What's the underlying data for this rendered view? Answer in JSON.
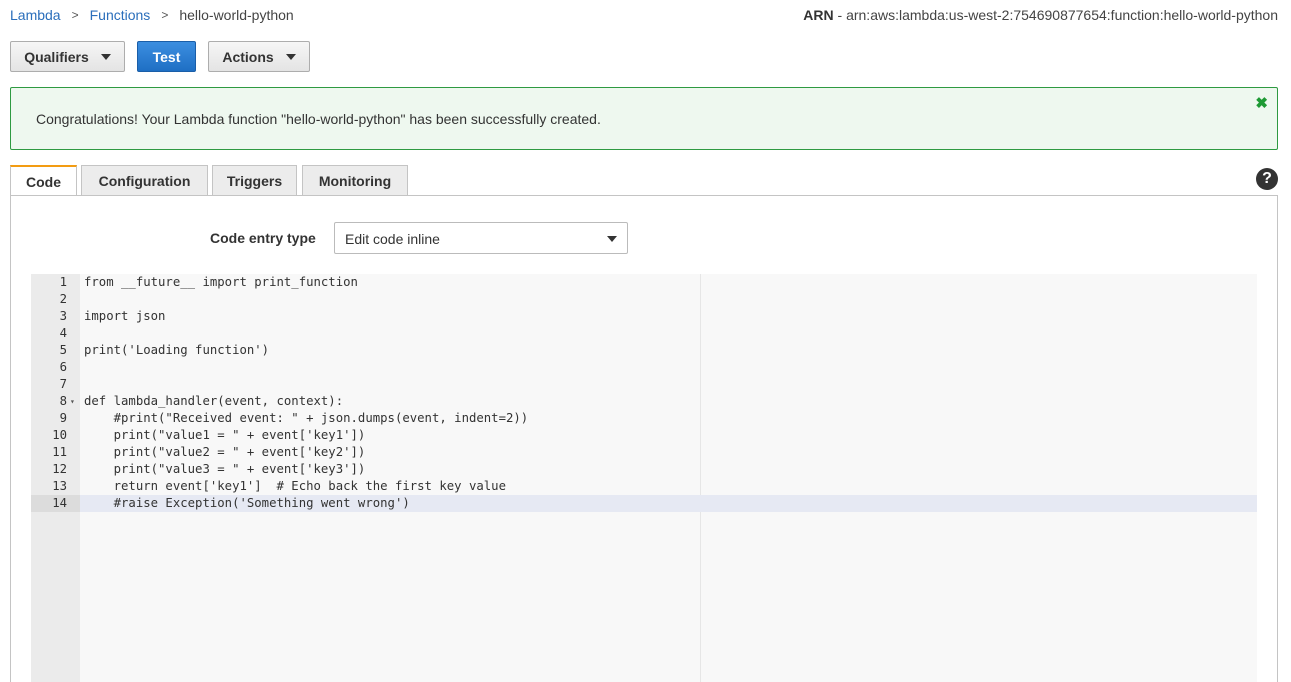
{
  "breadcrumb": {
    "lambda": "Lambda",
    "functions": "Functions",
    "current": "hello-world-python",
    "sep": ">"
  },
  "arn": {
    "label": "ARN",
    "value": " - arn:aws:lambda:us-west-2:754690877654:function:hello-world-python"
  },
  "toolbar": {
    "qualifiers": "Qualifiers",
    "test": "Test",
    "actions": "Actions"
  },
  "alert": {
    "message": "Congratulations! Your Lambda function \"hello-world-python\" has been successfully created.",
    "close": "✖"
  },
  "tabs": [
    {
      "label": "Code"
    },
    {
      "label": "Configuration"
    },
    {
      "label": "Triggers"
    },
    {
      "label": "Monitoring"
    }
  ],
  "help": "?",
  "code_entry": {
    "label": "Code entry type",
    "selected": "Edit code inline"
  },
  "editor": {
    "active_line": 14,
    "lines": [
      {
        "n": "1",
        "text": "from __future__ import print_function"
      },
      {
        "n": "2",
        "text": ""
      },
      {
        "n": "3",
        "text": "import json"
      },
      {
        "n": "4",
        "text": ""
      },
      {
        "n": "5",
        "text": "print('Loading function')"
      },
      {
        "n": "6",
        "text": ""
      },
      {
        "n": "7",
        "text": ""
      },
      {
        "n": "8",
        "text": "def lambda_handler(event, context):"
      },
      {
        "n": "9",
        "text": "    #print(\"Received event: \" + json.dumps(event, indent=2))"
      },
      {
        "n": "10",
        "text": "    print(\"value1 = \" + event['key1'])"
      },
      {
        "n": "11",
        "text": "    print(\"value2 = \" + event['key2'])"
      },
      {
        "n": "12",
        "text": "    print(\"value3 = \" + event['key3'])"
      },
      {
        "n": "13",
        "text": "    return event['key1']  # Echo back the first key value"
      },
      {
        "n": "14",
        "text": "    #raise Exception('Something went wrong')"
      }
    ]
  }
}
